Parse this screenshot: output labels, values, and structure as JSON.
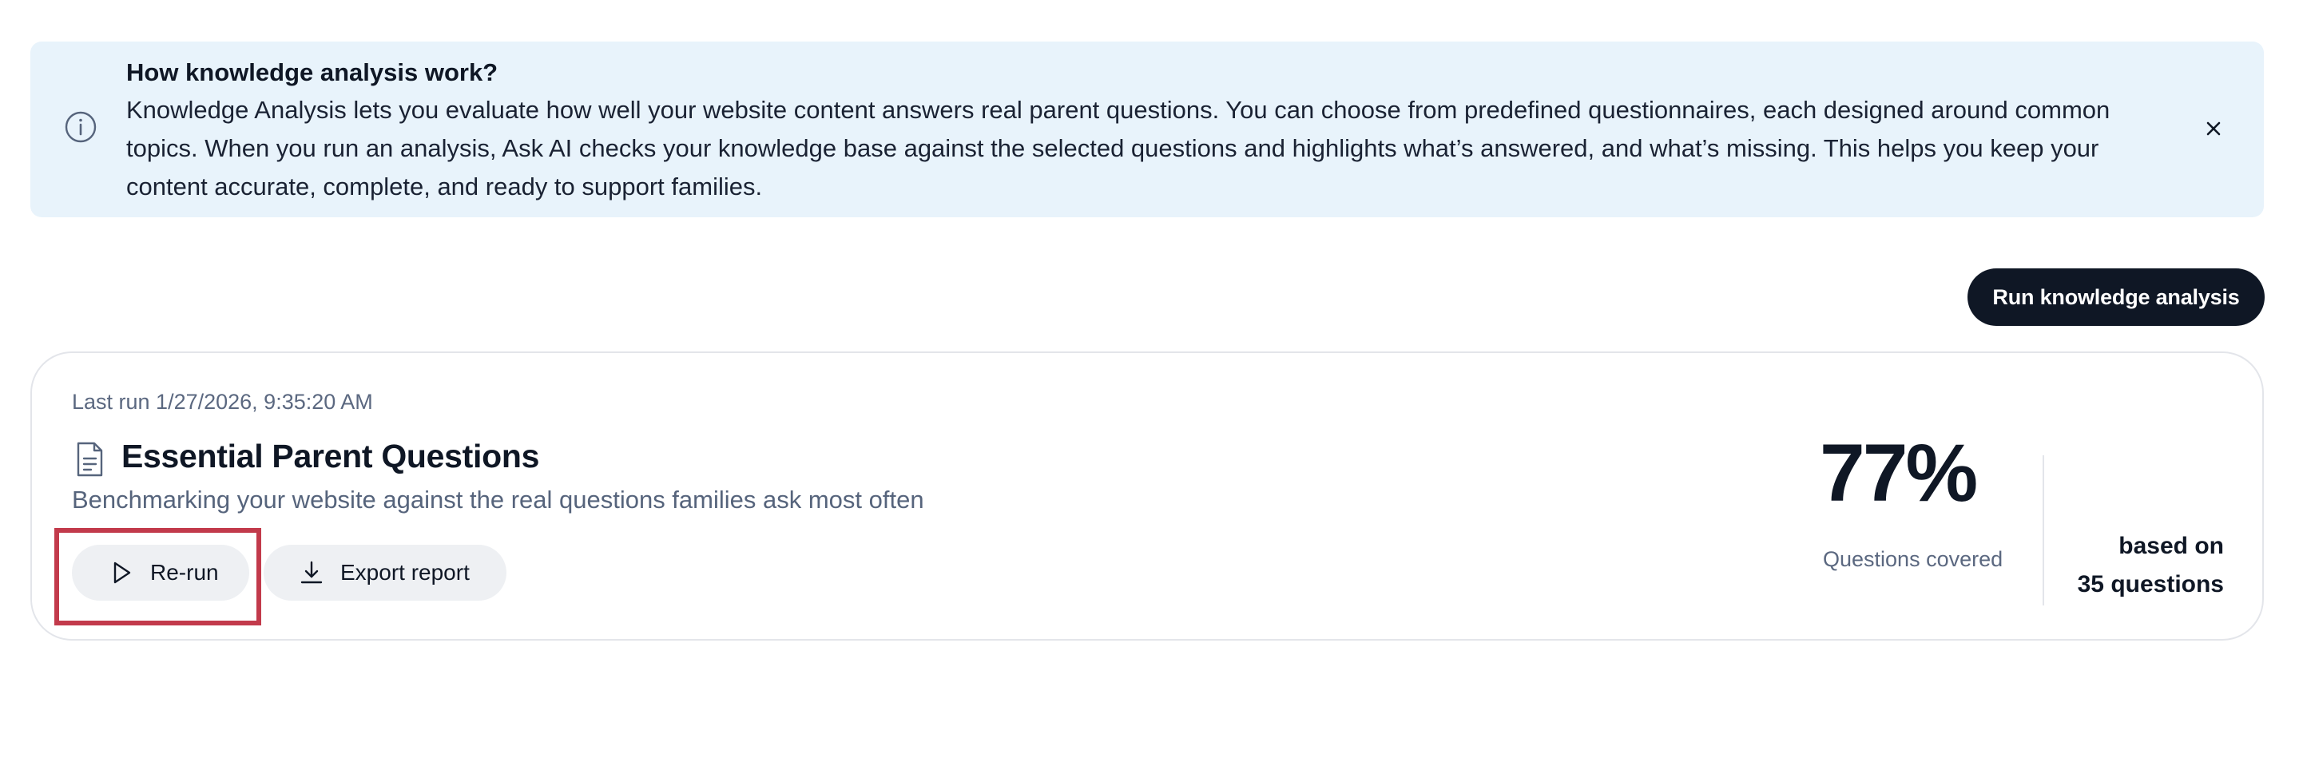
{
  "banner": {
    "title": "How knowledge analysis work?",
    "body": "Knowledge Analysis lets you evaluate how well your website content answers real parent questions. You can choose from predefined questionnaires, each designed around common topics. When you run an analysis, Ask AI checks your knowledge base against the selected questions and highlights what’s answered, and what’s missing. This helps you keep your content accurate, complete, and ready to support families.",
    "info_icon": "info-icon",
    "close_icon": "close-icon"
  },
  "toolbar": {
    "run_label": "Run knowledge analysis"
  },
  "card": {
    "last_run": "Last run 1/27/2026, 9:35:20 AM",
    "doc_icon": "document-icon",
    "title": "Essential Parent Questions",
    "subtitle": "Benchmarking your website against the real questions families ask most often",
    "rerun_label": "Re-run",
    "rerun_icon": "play-icon",
    "export_label": "Export report",
    "export_icon": "download-icon",
    "metric_value": "77%",
    "metric_label": "Questions covered",
    "based_on_line1": "based on",
    "based_on_line2": "35 questions"
  },
  "colors": {
    "banner_bg": "#e8f3fb",
    "primary": "#0f1725",
    "highlight": "#c23a4b",
    "muted_text": "#5b6880",
    "pill_bg": "#eef0f3"
  }
}
